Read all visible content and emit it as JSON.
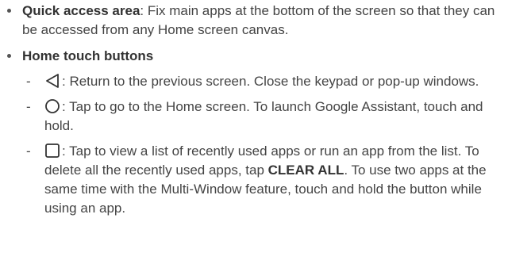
{
  "items": [
    {
      "title": "Quick access area",
      "text": ": Fix main apps at the bottom of the screen so that they can be accessed from any Home screen canvas."
    },
    {
      "title": "Home touch buttons",
      "subitems": [
        {
          "icon": "back-triangle-icon",
          "text": ": Return to the previous screen. Close the keypad or pop-up windows."
        },
        {
          "icon": "home-circle-icon",
          "text": ": Tap to go to the Home screen. To launch Google Assistant, touch and hold."
        },
        {
          "icon": "recent-apps-square-icon",
          "text_before": ": Tap to view a list of recently used apps or run an app from the list. To delete all the recently used apps, tap ",
          "emph": "CLEAR ALL",
          "text_after": ". To use two apps at the same time with the Multi-Window feature, touch and hold the button while using an app."
        }
      ]
    }
  ],
  "dash": "-"
}
